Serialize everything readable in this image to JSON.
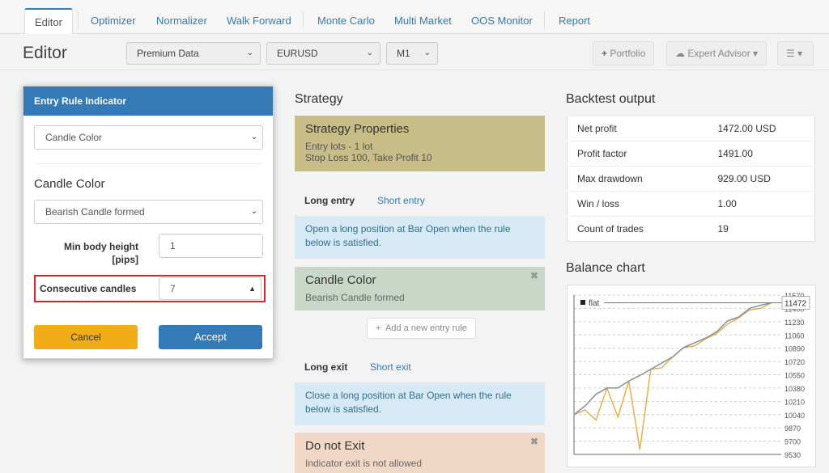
{
  "tabs": [
    "Editor",
    "Optimizer",
    "Normalizer",
    "Walk Forward",
    "Monte Carlo",
    "Multi Market",
    "OOS Monitor",
    "Report"
  ],
  "header": {
    "title": "Editor",
    "data_source": "Premium Data",
    "symbol": "EURUSD",
    "period": "M1",
    "portfolio": "Portfolio",
    "expert_advisor": "Expert Advisor",
    "menu_icon": "hamburger-icon"
  },
  "dialog": {
    "title": "Entry Rule Indicator",
    "indicator": "Candle Color",
    "section": "Candle Color",
    "mode": "Bearish Candle formed",
    "min_body_label": "Min body height [pips]",
    "min_body_value": "1",
    "consecutive_label": "Consecutive candles",
    "consecutive_value": "7",
    "cancel": "Cancel",
    "accept": "Accept",
    "highlight_color": "#d9232d"
  },
  "strategy": {
    "heading": "Strategy",
    "props_title": "Strategy Properties",
    "props_line1": "Entry lots - 1 lot",
    "props_line2": "Stop Loss 100, Take Profit 10",
    "long_entry": "Long entry",
    "short_entry": "Short entry",
    "entry_desc": "Open a long position at Bar Open when the rule below is satisfied.",
    "rule_title": "Candle Color",
    "rule_desc": "Bearish Candle formed",
    "add_rule": "Add a new entry rule",
    "long_exit": "Long exit",
    "short_exit": "Short exit",
    "exit_desc": "Close a long position at Bar Open when the rule below is satisfied.",
    "exit_title": "Do not Exit",
    "exit_line": "Indicator exit is not allowed"
  },
  "backtest": {
    "heading": "Backtest output",
    "rows": [
      [
        "Net profit",
        "1472.00 USD"
      ],
      [
        "Profit factor",
        "1491.00"
      ],
      [
        "Max drawdown",
        "929.00 USD"
      ],
      [
        "Win / loss",
        "1.00"
      ],
      [
        "Count of trades",
        "19"
      ]
    ]
  },
  "balance": {
    "heading": "Balance chart"
  },
  "chart_data": {
    "type": "line",
    "legend": "flat",
    "legend_placement": "top-left",
    "last_value_label": "11472",
    "ylim": [
      9530,
      11570
    ],
    "yticks": [
      11570,
      11400,
      11230,
      11060,
      10890,
      10720,
      10550,
      10380,
      10210,
      10040,
      9870,
      9700,
      9530
    ],
    "grid": true,
    "series": [
      {
        "name": "flat",
        "color": "#7f8fa6",
        "values": [
          10040,
          10150,
          10300,
          10380,
          10380,
          10470,
          10540,
          10620,
          10700,
          10780,
          10900,
          10960,
          11020,
          11100,
          11240,
          11290,
          11400,
          11440,
          11472
        ]
      },
      {
        "color": "#e8b04a",
        "values": [
          10040,
          10100,
          9970,
          10380,
          10010,
          10470,
          9590,
          10620,
          10640,
          10780,
          10900,
          10920,
          11010,
          11080,
          11200,
          11280,
          11380,
          11400,
          11472
        ]
      }
    ]
  }
}
